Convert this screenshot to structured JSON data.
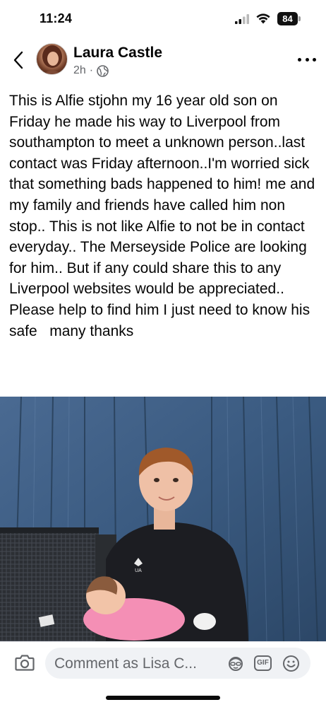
{
  "status_bar": {
    "time": "11:24",
    "battery_level": "84",
    "icons": [
      "cellular-signal-icon",
      "wifi-icon",
      "battery-icon"
    ]
  },
  "post": {
    "author_name": "Laura Castle",
    "timestamp": "2h",
    "separator": "·",
    "audience_icon": "globe-icon",
    "text": "This is Alfie stjohn my 16 year old son on Friday he made his way to Liverpool from southampton to meet a unknown person..last contact was Friday afternoon..I'm worried sick that something bads happened to him! me and my family and friends have called him non stop.. This is not like Alfie to not be in contact everyday.. The Merseyside Police are looking for him.. But if any could share this to any Liverpool websites would be appreciated.. Please help to find him I just need to know his safe   many thanks"
  },
  "photo": {
    "brand_logo_text": "UA"
  },
  "comment_bar": {
    "placeholder": "Comment as Lisa C...",
    "gif_label": "GIF",
    "icons": [
      "camera-icon",
      "avatar-sticker-icon",
      "gif-icon",
      "emoji-icon"
    ]
  },
  "colors": {
    "text_primary": "#050505",
    "text_secondary": "#65676b",
    "input_background": "#f0f2f5",
    "fence_blue": "#3f5f86"
  }
}
